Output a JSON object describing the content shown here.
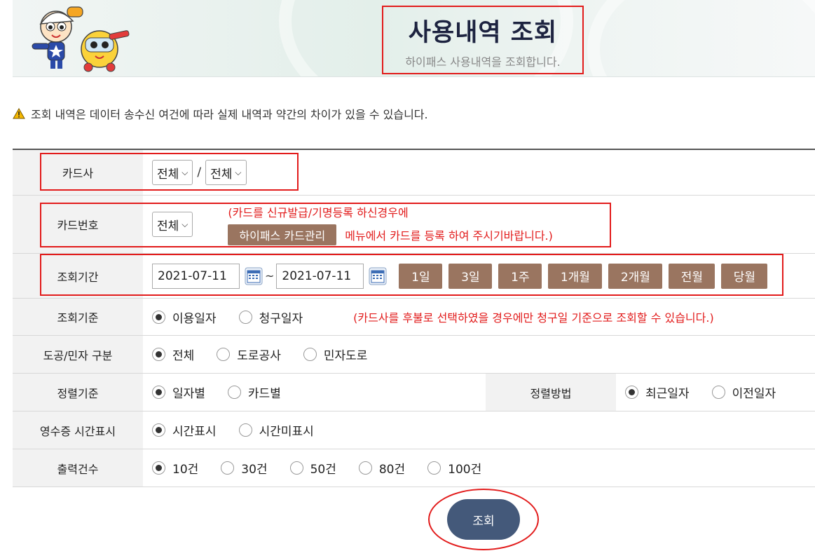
{
  "header": {
    "title": "사용내역 조회",
    "subtitle": "하이패스 사용내역을 조회합니다."
  },
  "notice": {
    "text": "조회 내역은 데이터 송수신 여건에 따라 실제 내역과 약간의 차이가 있을 수 있습니다."
  },
  "card_company": {
    "label": "카드사",
    "select1": "전체",
    "separator": "/",
    "select2": "전체"
  },
  "card_number": {
    "label": "카드번호",
    "select": "전체",
    "note_line1": "(카드를 신규발급/기명등록 하신경우에",
    "manage_button": "하이패스 카드관리",
    "note_line2": "메뉴에서 카드를 등록 하여 주시기바랍니다.)"
  },
  "period": {
    "label": "조회기간",
    "start_date": "2021-07-11",
    "tilde": "~",
    "end_date": "2021-07-11",
    "buttons": [
      "1일",
      "3일",
      "1주",
      "1개월",
      "2개월",
      "전월",
      "당월"
    ]
  },
  "basis": {
    "label": "조회기준",
    "options": [
      "이용일자",
      "청구일자"
    ],
    "selected": 0,
    "note": "(카드사를 후불로 선택하였을 경우에만 청구일 기준으로 조회할 수 있습니다.)"
  },
  "road_type": {
    "label": "도공/민자 구분",
    "options": [
      "전체",
      "도로공사",
      "민자도로"
    ],
    "selected": 0
  },
  "sort_basis": {
    "label": "정렬기준",
    "options": [
      "일자별",
      "카드별"
    ],
    "selected": 0
  },
  "sort_order": {
    "label": "정렬방법",
    "options": [
      "최근일자",
      "이전일자"
    ],
    "selected": 0
  },
  "receipt_time": {
    "label": "영수증 시간표시",
    "options": [
      "시간표시",
      "시간미표시"
    ],
    "selected": 0
  },
  "output_count": {
    "label": "출력건수",
    "options": [
      "10건",
      "30건",
      "50건",
      "80건",
      "100건"
    ],
    "selected": 0
  },
  "submit": {
    "label": "조회"
  },
  "colors": {
    "accent_red": "#e21b1b",
    "period_button": "#9a7560",
    "submit_button": "#44597a",
    "title_navy": "#1d2340"
  },
  "icons": [
    "warning-icon",
    "calendar-icon",
    "chevron-down-icon",
    "mascot-logo"
  ]
}
